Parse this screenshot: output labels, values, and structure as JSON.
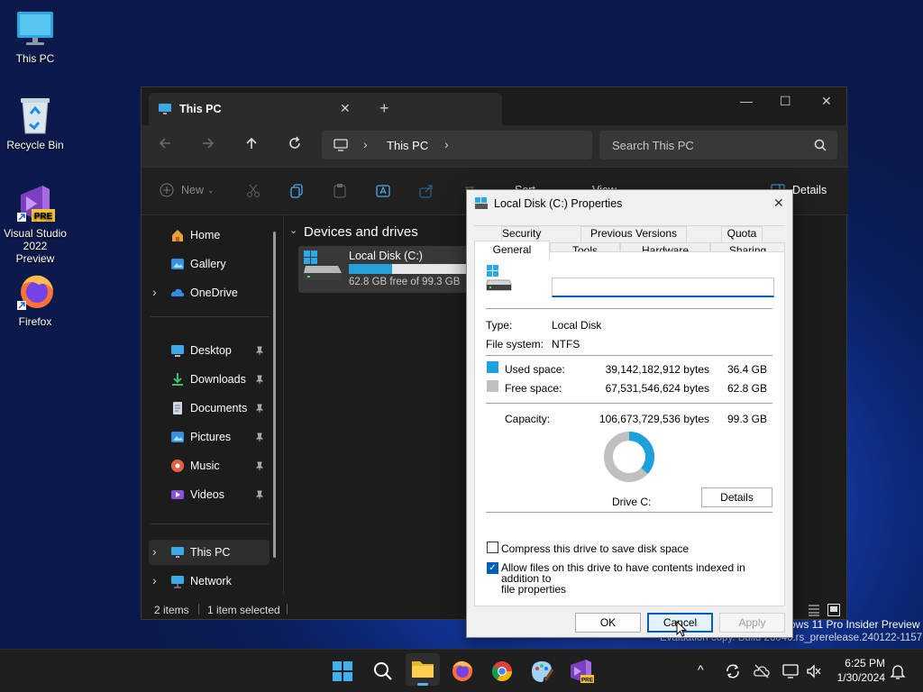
{
  "desktop": {
    "icons": [
      {
        "label": "This PC"
      },
      {
        "label": "Recycle Bin"
      },
      {
        "label": "Visual Studio 2022 Preview"
      },
      {
        "label": "Firefox"
      }
    ],
    "watermark_line1": "ows 11 Pro Insider Preview",
    "watermark_line2": "Evaluation copy. Build 26040.rs_prerelease.240122-1157"
  },
  "explorer": {
    "tab_title": "This PC",
    "close_tab": "✕",
    "new_tab": "+",
    "window_controls": {
      "minimize": "—",
      "maximize": "☐",
      "close": "✕"
    },
    "breadcrumb": {
      "location": "This PC",
      "sep": "›"
    },
    "search_placeholder": "Search This PC",
    "toolbar": {
      "new_label": "New",
      "sort_label": "Sort",
      "view_label": "View",
      "more": "···",
      "details_label": "Details"
    },
    "sidebar": {
      "quick": [
        {
          "label": "Home",
          "icon": "home-icon"
        },
        {
          "label": "Gallery",
          "icon": "gallery-icon"
        },
        {
          "label": "OneDrive",
          "icon": "onedrive-icon",
          "expander": "›"
        }
      ],
      "pinned": [
        {
          "label": "Desktop",
          "icon": "desktop-folder-icon"
        },
        {
          "label": "Downloads",
          "icon": "downloads-icon"
        },
        {
          "label": "Documents",
          "icon": "documents-icon"
        },
        {
          "label": "Pictures",
          "icon": "pictures-icon"
        },
        {
          "label": "Music",
          "icon": "music-icon"
        },
        {
          "label": "Videos",
          "icon": "videos-icon"
        }
      ],
      "bottom": [
        {
          "label": "This PC",
          "icon": "this-pc-icon",
          "expander": "›",
          "selected": true
        },
        {
          "label": "Network",
          "icon": "network-icon",
          "expander": "›"
        }
      ],
      "pin_glyph": "📌"
    },
    "content": {
      "group_header": "Devices and drives",
      "group_chevron": "⌄",
      "drive": {
        "name": "Local Disk (C:)",
        "free_text": "62.8 GB free of 99.3 GB",
        "used_fraction": 0.367
      }
    },
    "status": {
      "items": "2 items",
      "selected": "1 item selected"
    }
  },
  "dialog": {
    "title": "Local Disk (C:) Properties",
    "close": "✕",
    "tabs_row1": [
      "Security",
      "Previous Versions",
      "Quota"
    ],
    "tabs_row2": [
      "General",
      "Tools",
      "Hardware",
      "Sharing"
    ],
    "active_tab": "General",
    "label_value": "",
    "type_label": "Type:",
    "type_value": "Local Disk",
    "fs_label": "File system:",
    "fs_value": "NTFS",
    "used_label": "Used space:",
    "used_bytes": "39,142,182,912 bytes",
    "used_gb": "36.4 GB",
    "free_label": "Free space:",
    "free_bytes": "67,531,546,624 bytes",
    "free_gb": "62.8 GB",
    "capacity_label": "Capacity:",
    "capacity_bytes": "106,673,729,536 bytes",
    "capacity_gb": "99.3 GB",
    "drive_label": "Drive C:",
    "details_button": "Details",
    "compress_label": "Compress this drive to save disk space",
    "compress_checked": false,
    "index_label_line1": "Allow files on this drive to have contents indexed in addition to",
    "index_label_line2": "file properties",
    "index_checked": true,
    "check_glyph": "✓",
    "ok": "OK",
    "cancel": "Cancel",
    "apply": "Apply",
    "used_color": "#1ca0de",
    "free_color": "#c0c0c0",
    "used_fraction": 0.367
  },
  "taskbar": {
    "time": "6:25 PM",
    "date": "1/30/2024",
    "tray_chevron": "^",
    "apps": [
      "start-icon",
      "search-icon",
      "file-explorer-icon",
      "firefox-icon",
      "chrome-icon",
      "paint-icon",
      "visual-studio-icon"
    ]
  }
}
